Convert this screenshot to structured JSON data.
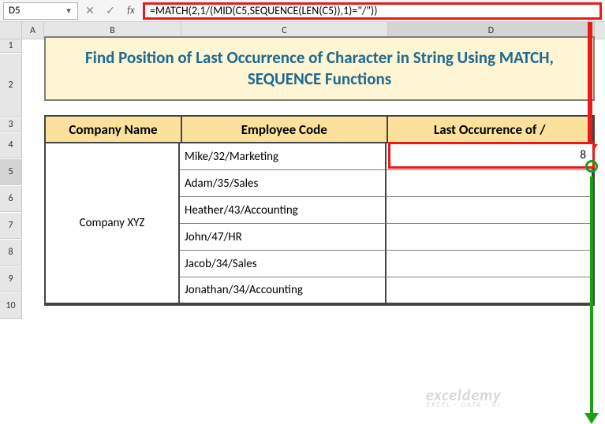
{
  "namebox": {
    "value": "D5"
  },
  "formula_bar": {
    "value": "=MATCH(2,1/(MID(C5,SEQUENCE(LEN(C5)),1)=\"/\"))"
  },
  "columns": {
    "A": "A",
    "B": "B",
    "C": "C",
    "D": "D"
  },
  "rows": [
    "1",
    "2",
    "3",
    "4",
    "5",
    "6",
    "7",
    "8",
    "9",
    "10"
  ],
  "title": "Find Position of Last Occurrence of Character in String Using MATCH, SEQUENCE Functions",
  "headers": {
    "company": "Company Name",
    "employee": "Employee Code",
    "last": "Last Occurrence of /"
  },
  "company": "Company XYZ",
  "employees": [
    "Mike/32/Marketing",
    "Adam/35/Sales",
    "Heather/43/Accounting",
    "John/47/HR",
    "Jacob/34/Sales",
    "Jonathan/34/Accounting"
  ],
  "result_d5": "8",
  "watermark": {
    "main": "exceldemy",
    "sub": "EXCEL · DATA · BI"
  }
}
